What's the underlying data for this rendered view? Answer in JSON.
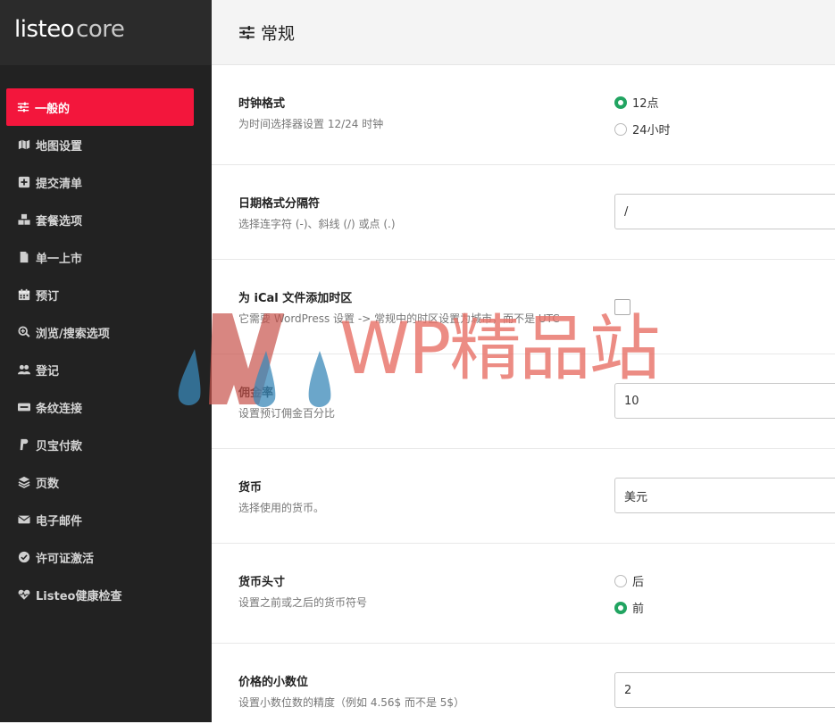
{
  "app": {
    "logo_primary": "listeo",
    "logo_secondary": "core"
  },
  "header": {
    "title": "常规",
    "title_icon": "sliders-icon"
  },
  "sidebar": {
    "items": [
      {
        "label": "一般的",
        "icon": "sliders-icon",
        "active": true
      },
      {
        "label": "地图设置",
        "icon": "map-icon",
        "active": false
      },
      {
        "label": "提交清单",
        "icon": "plus-square-icon",
        "active": false
      },
      {
        "label": "套餐选项",
        "icon": "cubes-icon",
        "active": false
      },
      {
        "label": "单一上市",
        "icon": "file-icon",
        "active": false
      },
      {
        "label": "预订",
        "icon": "calendar-icon",
        "active": false
      },
      {
        "label": "浏览/搜索选项",
        "icon": "search-plus-icon",
        "active": false
      },
      {
        "label": "登记",
        "icon": "users-icon",
        "active": false
      },
      {
        "label": "条纹连接",
        "icon": "stripe-icon",
        "active": false
      },
      {
        "label": "贝宝付款",
        "icon": "paypal-icon",
        "active": false
      },
      {
        "label": "页数",
        "icon": "layers-icon",
        "active": false
      },
      {
        "label": "电子邮件",
        "icon": "envelope-icon",
        "active": false
      },
      {
        "label": "许可证激活",
        "icon": "check-circle-icon",
        "active": false
      },
      {
        "label": "Listeo健康检查",
        "icon": "heartbeat-icon",
        "active": false
      }
    ]
  },
  "settings": {
    "clock": {
      "label": "时钟格式",
      "desc": "为时间选择器设置 12/24 时钟",
      "options": [
        {
          "label": "12点",
          "checked": true
        },
        {
          "label": "24小时",
          "checked": false
        }
      ]
    },
    "date_sep": {
      "label": "日期格式分隔符",
      "desc": "选择连字符 (-)、斜线 (/) 或点 (.)",
      "value": "/"
    },
    "ical": {
      "label": "为 iCal 文件添加时区",
      "desc": "它需要 WordPress 设置 -> 常规中的时区设置为城市，而不是 UTC",
      "checked": false
    },
    "commission": {
      "label": "佣金率",
      "desc": "设置预订佣金百分比",
      "value": "10"
    },
    "currency": {
      "label": "货币",
      "desc": "选择使用的货币。",
      "value": "美元"
    },
    "currency_pos": {
      "label": "货币头寸",
      "desc": "设置之前或之后的货币符号",
      "options": [
        {
          "label": "后",
          "checked": false
        },
        {
          "label": "前",
          "checked": true
        }
      ]
    },
    "decimals": {
      "label": "价格的小数位",
      "desc": "设置小数位数的精度（例如 4.56$ 而不是 5$）",
      "value": "2"
    }
  },
  "watermark": {
    "text": "WP精品站"
  },
  "colors": {
    "accent": "#f3163c",
    "radio_on": "#21a461",
    "sidebar_bg": "#222222"
  }
}
